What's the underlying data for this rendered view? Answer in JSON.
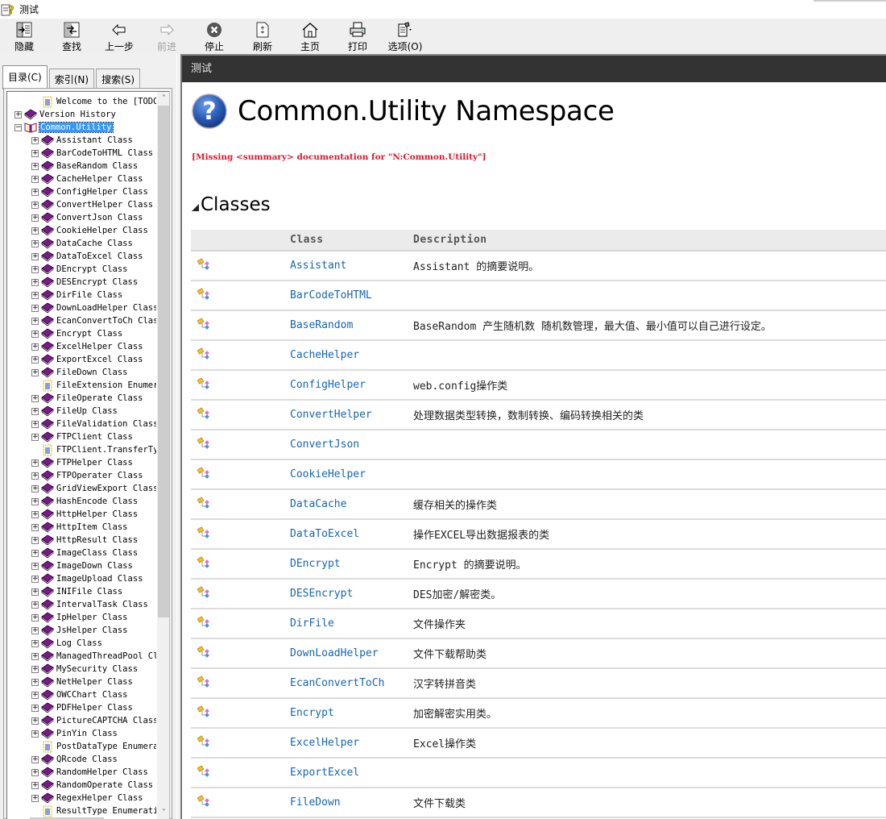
{
  "window": {
    "title": "测试",
    "icon": "help-file-icon"
  },
  "toolbar": {
    "buttons": [
      {
        "label": "隐藏",
        "icon": "hide-pane-icon",
        "enabled": true
      },
      {
        "label": "查找",
        "icon": "locate-icon",
        "enabled": true
      },
      {
        "label": "上一步",
        "icon": "back-arrow-icon",
        "enabled": true
      },
      {
        "label": "前进",
        "icon": "forward-arrow-icon",
        "enabled": false
      },
      {
        "label": "停止",
        "icon": "stop-icon",
        "enabled": true
      },
      {
        "label": "刷新",
        "icon": "refresh-icon",
        "enabled": true
      },
      {
        "label": "主页",
        "icon": "home-icon",
        "enabled": true
      },
      {
        "label": "打印",
        "icon": "print-icon",
        "enabled": true
      },
      {
        "label": "选项(O)",
        "icon": "options-icon",
        "enabled": true
      }
    ]
  },
  "nav_tabs": [
    {
      "label": "目录(C)",
      "active": true
    },
    {
      "label": "索引(N)",
      "active": false
    },
    {
      "label": "搜索(S)",
      "active": false
    }
  ],
  "tree": {
    "items": [
      {
        "label": "Welcome to the [TODO: A",
        "level": 1,
        "expander": "none",
        "icon": "page"
      },
      {
        "label": "Version History",
        "level": 0,
        "expander": "plus",
        "icon": "book"
      },
      {
        "label": "Common.Utility",
        "level": 0,
        "expander": "minus",
        "icon": "open-book",
        "selected": true
      },
      {
        "label": "Assistant Class",
        "level": 1,
        "expander": "plus",
        "icon": "book"
      },
      {
        "label": "BarCodeToHTML Class",
        "level": 1,
        "expander": "plus",
        "icon": "book"
      },
      {
        "label": "BaseRandom Class",
        "level": 1,
        "expander": "plus",
        "icon": "book"
      },
      {
        "label": "CacheHelper Class",
        "level": 1,
        "expander": "plus",
        "icon": "book"
      },
      {
        "label": "ConfigHelper Class",
        "level": 1,
        "expander": "plus",
        "icon": "book"
      },
      {
        "label": "ConvertHelper Class",
        "level": 1,
        "expander": "plus",
        "icon": "book"
      },
      {
        "label": "ConvertJson Class",
        "level": 1,
        "expander": "plus",
        "icon": "book"
      },
      {
        "label": "CookieHelper Class",
        "level": 1,
        "expander": "plus",
        "icon": "book"
      },
      {
        "label": "DataCache Class",
        "level": 1,
        "expander": "plus",
        "icon": "book"
      },
      {
        "label": "DataToExcel Class",
        "level": 1,
        "expander": "plus",
        "icon": "book"
      },
      {
        "label": "DEncrypt Class",
        "level": 1,
        "expander": "plus",
        "icon": "book"
      },
      {
        "label": "DESEncrypt Class",
        "level": 1,
        "expander": "plus",
        "icon": "book"
      },
      {
        "label": "DirFile Class",
        "level": 1,
        "expander": "plus",
        "icon": "book"
      },
      {
        "label": "DownLoadHelper Class",
        "level": 1,
        "expander": "plus",
        "icon": "book"
      },
      {
        "label": "EcanConvertToCh Class",
        "level": 1,
        "expander": "plus",
        "icon": "book"
      },
      {
        "label": "Encrypt Class",
        "level": 1,
        "expander": "plus",
        "icon": "book"
      },
      {
        "label": "ExcelHelper Class",
        "level": 1,
        "expander": "plus",
        "icon": "book"
      },
      {
        "label": "ExportExcel Class",
        "level": 1,
        "expander": "plus",
        "icon": "book"
      },
      {
        "label": "FileDown Class",
        "level": 1,
        "expander": "plus",
        "icon": "book"
      },
      {
        "label": "FileExtension Enumer",
        "level": 1,
        "expander": "none",
        "icon": "page"
      },
      {
        "label": "FileOperate Class",
        "level": 1,
        "expander": "plus",
        "icon": "book"
      },
      {
        "label": "FileUp Class",
        "level": 1,
        "expander": "plus",
        "icon": "book"
      },
      {
        "label": "FileValidation Class",
        "level": 1,
        "expander": "plus",
        "icon": "book"
      },
      {
        "label": "FTPClient Class",
        "level": 1,
        "expander": "plus",
        "icon": "book"
      },
      {
        "label": "FTPClient.TransferTy",
        "level": 1,
        "expander": "none",
        "icon": "page"
      },
      {
        "label": "FTPHelper Class",
        "level": 1,
        "expander": "plus",
        "icon": "book"
      },
      {
        "label": "FTPOperater Class",
        "level": 1,
        "expander": "plus",
        "icon": "book"
      },
      {
        "label": "GridViewExport Class",
        "level": 1,
        "expander": "plus",
        "icon": "book"
      },
      {
        "label": "HashEncode Class",
        "level": 1,
        "expander": "plus",
        "icon": "book"
      },
      {
        "label": "HttpHelper Class",
        "level": 1,
        "expander": "plus",
        "icon": "book"
      },
      {
        "label": "HttpItem Class",
        "level": 1,
        "expander": "plus",
        "icon": "book"
      },
      {
        "label": "HttpResult Class",
        "level": 1,
        "expander": "plus",
        "icon": "book"
      },
      {
        "label": "ImageClass Class",
        "level": 1,
        "expander": "plus",
        "icon": "book"
      },
      {
        "label": "ImageDown Class",
        "level": 1,
        "expander": "plus",
        "icon": "book"
      },
      {
        "label": "ImageUpload Class",
        "level": 1,
        "expander": "plus",
        "icon": "book"
      },
      {
        "label": "INIFile Class",
        "level": 1,
        "expander": "plus",
        "icon": "book"
      },
      {
        "label": "IntervalTask Class",
        "level": 1,
        "expander": "plus",
        "icon": "book"
      },
      {
        "label": "IpHelper Class",
        "level": 1,
        "expander": "plus",
        "icon": "book"
      },
      {
        "label": "JsHelper Class",
        "level": 1,
        "expander": "plus",
        "icon": "book"
      },
      {
        "label": "Log Class",
        "level": 1,
        "expander": "plus",
        "icon": "book"
      },
      {
        "label": "ManagedThreadPool Cl",
        "level": 1,
        "expander": "plus",
        "icon": "book"
      },
      {
        "label": "MySecurity Class",
        "level": 1,
        "expander": "plus",
        "icon": "book"
      },
      {
        "label": "NetHelper Class",
        "level": 1,
        "expander": "plus",
        "icon": "book"
      },
      {
        "label": "OWCChart Class",
        "level": 1,
        "expander": "plus",
        "icon": "book"
      },
      {
        "label": "PDFHelper Class",
        "level": 1,
        "expander": "plus",
        "icon": "book"
      },
      {
        "label": "PictureCAPTCHA Class",
        "level": 1,
        "expander": "plus",
        "icon": "book"
      },
      {
        "label": "PinYin Class",
        "level": 1,
        "expander": "plus",
        "icon": "book"
      },
      {
        "label": "PostDataType Enumera",
        "level": 1,
        "expander": "none",
        "icon": "page"
      },
      {
        "label": "QRcode Class",
        "level": 1,
        "expander": "plus",
        "icon": "book"
      },
      {
        "label": "RandomHelper Class",
        "level": 1,
        "expander": "plus",
        "icon": "book"
      },
      {
        "label": "RandomOperate Class",
        "level": 1,
        "expander": "plus",
        "icon": "book"
      },
      {
        "label": "RegexHelper Class",
        "level": 1,
        "expander": "plus",
        "icon": "book"
      },
      {
        "label": "ResultType Enumerati",
        "level": 1,
        "expander": "none",
        "icon": "page"
      }
    ]
  },
  "content": {
    "topic_title": "测试",
    "page_title": "Common.Utility Namespace",
    "missing_summary": "[Missing <summary> documentation for \"N:Common.Utility\"]",
    "section_title": "Classes",
    "table": {
      "headers": {
        "icon": "",
        "name": "Class",
        "description": "Description"
      },
      "rows": [
        {
          "name": "Assistant",
          "description": "Assistant 的摘要说明。"
        },
        {
          "name": "BarCodeToHTML",
          "description": ""
        },
        {
          "name": "BaseRandom",
          "description": "BaseRandom 产生随机数 随机数管理，最大值、最小值可以自己进行设定。"
        },
        {
          "name": "CacheHelper",
          "description": ""
        },
        {
          "name": "ConfigHelper",
          "description": "web.config操作类"
        },
        {
          "name": "ConvertHelper",
          "description": "处理数据类型转换，数制转换、编码转换相关的类"
        },
        {
          "name": "ConvertJson",
          "description": ""
        },
        {
          "name": "CookieHelper",
          "description": ""
        },
        {
          "name": "DataCache",
          "description": "缓存相关的操作类"
        },
        {
          "name": "DataToExcel",
          "description": "操作EXCEL导出数据报表的类"
        },
        {
          "name": "DEncrypt",
          "description": "Encrypt 的摘要说明。"
        },
        {
          "name": "DESEncrypt",
          "description": "DES加密/解密类。"
        },
        {
          "name": "DirFile",
          "description": "文件操作夹"
        },
        {
          "name": "DownLoadHelper",
          "description": "文件下载帮助类"
        },
        {
          "name": "EcanConvertToCh",
          "description": "汉字转拼音类"
        },
        {
          "name": "Encrypt",
          "description": "加密解密实用类。"
        },
        {
          "name": "ExcelHelper",
          "description": "Excel操作类"
        },
        {
          "name": "ExportExcel",
          "description": ""
        },
        {
          "name": "FileDown",
          "description": "文件下载类"
        }
      ]
    }
  },
  "colors": {
    "link": "#1565b5",
    "missing_doc": "#e0162b",
    "topic_bar": "#333333",
    "selection": "#3399ff",
    "book": "#7a1a8a"
  }
}
